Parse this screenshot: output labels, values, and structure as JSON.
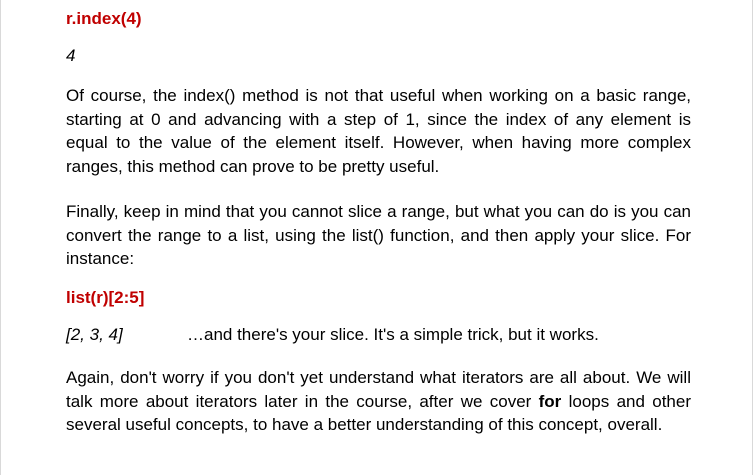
{
  "code_1": {
    "text": "r.index(4)",
    "color": "#c00000"
  },
  "output_1": "4",
  "paragraph_1": "Of course, the index() method is not that useful when working on a basic range, starting at 0 and advancing with a step of 1, since the index of any element is equal to the value of the element itself. However, when having more complex ranges, this method can prove to be pretty useful.",
  "paragraph_2": "Finally, keep in mind that you cannot slice a range, but what you can do is you can convert the range to a list, using the list() function, and then apply your slice. For instance:",
  "code_2": {
    "text": "list(r)[2:5]",
    "color": "#c00000"
  },
  "output_2": "[2, 3, 4]",
  "output_2_note": "…and there's your slice. It's a simple trick, but it works.",
  "paragraph_3": {
    "before": "Again, don't worry if you don't yet understand what iterators are all about. We will talk more about iterators later in the course, after we cover ",
    "bold": "for",
    "after": " loops and other several useful concepts, to have a better understanding of this concept, overall."
  }
}
